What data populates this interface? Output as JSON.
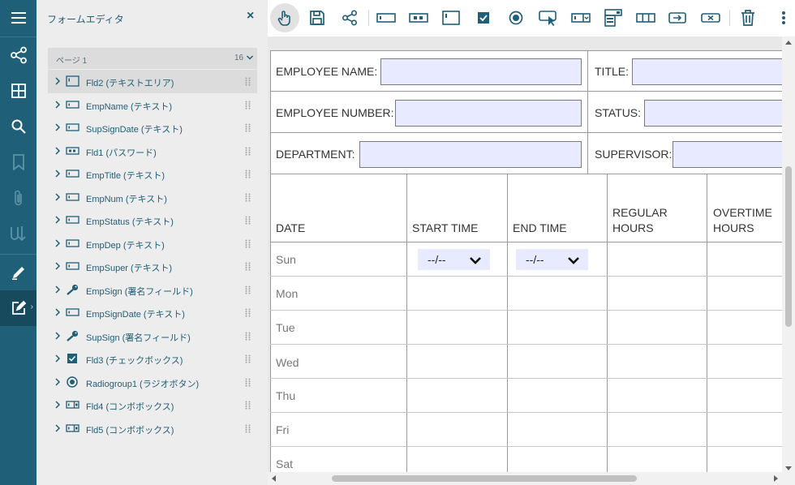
{
  "sidebar": {
    "title": "フォームエディタ",
    "close": "×",
    "page": {
      "label": "ページ 1",
      "count": "16"
    },
    "items": [
      {
        "label": "Fld2 (テキストエリア)",
        "icon": "textarea-field-icon",
        "selected": true
      },
      {
        "label": "EmpName (テキスト)",
        "icon": "text-field-icon"
      },
      {
        "label": "SupSignDate (テキスト)",
        "icon": "text-field-icon"
      },
      {
        "label": "Fld1 (パスワード)",
        "icon": "password-field-icon"
      },
      {
        "label": "EmpTitle (テキスト)",
        "icon": "text-field-icon"
      },
      {
        "label": "EmpNum (テキスト)",
        "icon": "text-field-icon"
      },
      {
        "label": "EmpStatus (テキスト)",
        "icon": "text-field-icon"
      },
      {
        "label": "EmpDep (テキスト)",
        "icon": "text-field-icon"
      },
      {
        "label": "EmpSuper (テキスト)",
        "icon": "text-field-icon"
      },
      {
        "label": "EmpSign (署名フィールド)",
        "icon": "signature-field-icon"
      },
      {
        "label": "EmpSignDate (テキスト)",
        "icon": "text-field-icon"
      },
      {
        "label": "SupSign (署名フィールド)",
        "icon": "signature-field-icon"
      },
      {
        "label": "Fld3 (チェックボックス)",
        "icon": "checkbox-field-icon"
      },
      {
        "label": "Radiogroup1 (ラジオボタン)",
        "icon": "radio-field-icon"
      },
      {
        "label": "Fld4 (コンボボックス)",
        "icon": "combobox-field-icon"
      },
      {
        "label": "Fld5 (コンボボックス)",
        "icon": "combobox-field-icon"
      }
    ]
  },
  "rail": [
    "menu-icon",
    "share-icon",
    "thumbnails-icon",
    "search-icon",
    "bookmark-icon",
    "attachment-icon",
    "signature-icon",
    "pencil-icon",
    "form-editor-icon"
  ],
  "toolbar": [
    "pointer-icon",
    "save-icon",
    "share-icon",
    "textbox-icon",
    "password-icon",
    "textarea-icon",
    "checkbox-icon",
    "radio-icon",
    "push-button-icon",
    "combobox-icon",
    "listbox-icon",
    "comb-field-icon",
    "signature-field-icon",
    "clear-field-icon",
    "delete-icon",
    "more-icon"
  ],
  "form": {
    "rows": [
      {
        "left_label": "EMPLOYEE NAME:",
        "right_label": "TITLE:"
      },
      {
        "left_label": "EMPLOYEE NUMBER:",
        "right_label": "STATUS:"
      },
      {
        "left_label": "DEPARTMENT:",
        "right_label": "SUPERVISOR:"
      }
    ],
    "table_headers": [
      "DATE",
      "START TIME",
      "END TIME",
      "REGULAR HOURS",
      "OVERTIME HOURS"
    ],
    "days": [
      "Sun",
      "Mon",
      "Tue",
      "Wed",
      "Thu",
      "Fri",
      "Sat"
    ],
    "dropdown_value": "--/--"
  },
  "colors": {
    "rail": "#205f78",
    "panel": "#ededed",
    "field_fill": "#e8ebff",
    "accent": "#205f78"
  }
}
